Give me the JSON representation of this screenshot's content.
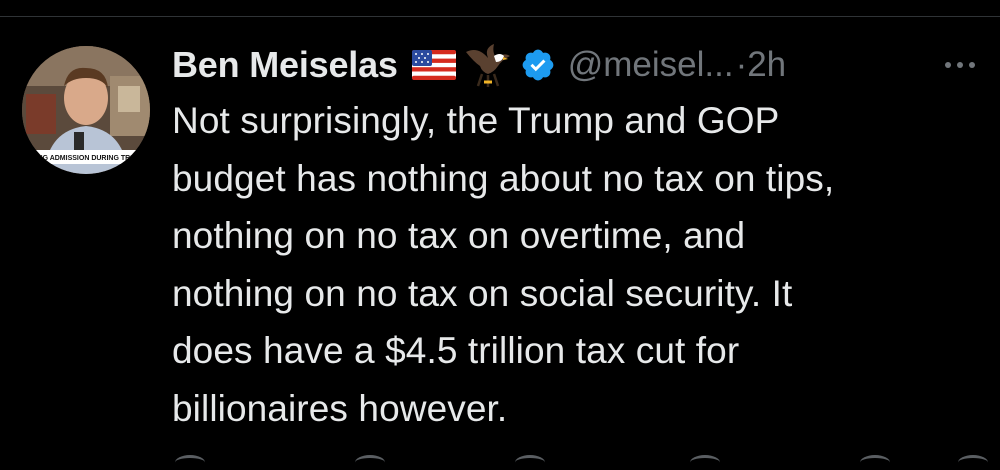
{
  "tweet": {
    "display_name": "Ben Meiselas",
    "handle": "@meisel...",
    "separator": "·",
    "timestamp": "2h",
    "text": "Not surprisingly, the Trump and GOP\nbudget has nothing about no tax on tips,\nnothing on no tax on overtime, and\nnothing on no tax on social security. It\ndoes have a $4.5 trillion tax cut for\nbillionaires however.",
    "avatar_caption": "NING ADMISSION DURING TRIAL"
  },
  "icons": {
    "flag": "us-flag-icon",
    "eagle": "eagle-icon",
    "verified": "verified-badge-icon",
    "more": "more-options-icon"
  },
  "colors": {
    "background": "#000000",
    "primary_text": "#e7e9ea",
    "secondary_text": "#71767b",
    "verified_blue": "#1d9bf0",
    "divider": "#2f3336"
  }
}
